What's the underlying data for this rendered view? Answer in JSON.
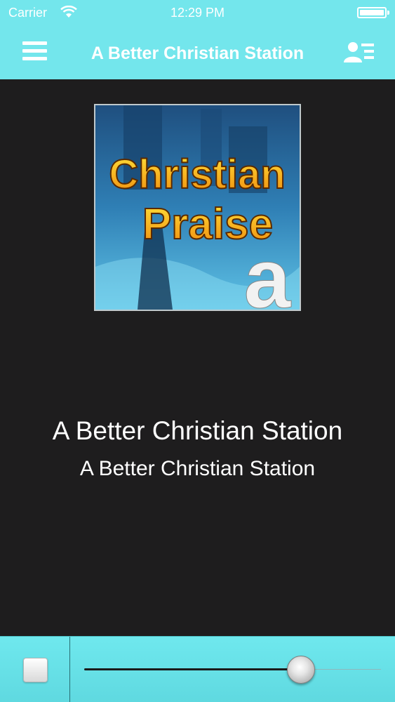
{
  "status_bar": {
    "carrier": "Carrier",
    "time": "12:29 PM"
  },
  "nav": {
    "title": "A Better Christian Station",
    "menu_icon": "hamburger-menu-icon",
    "contact_icon": "contact-list-icon"
  },
  "artwork": {
    "line1": "Christian",
    "line2": "Praise",
    "badge": "a"
  },
  "now_playing": {
    "title": "A Better Christian Station",
    "subtitle": "A Better Christian Station"
  },
  "player": {
    "stop_icon": "stop-icon",
    "volume_level": 0.73
  },
  "colors": {
    "accent": "#73e6ec",
    "background": "#1e1d1e",
    "text": "#ffffff"
  }
}
